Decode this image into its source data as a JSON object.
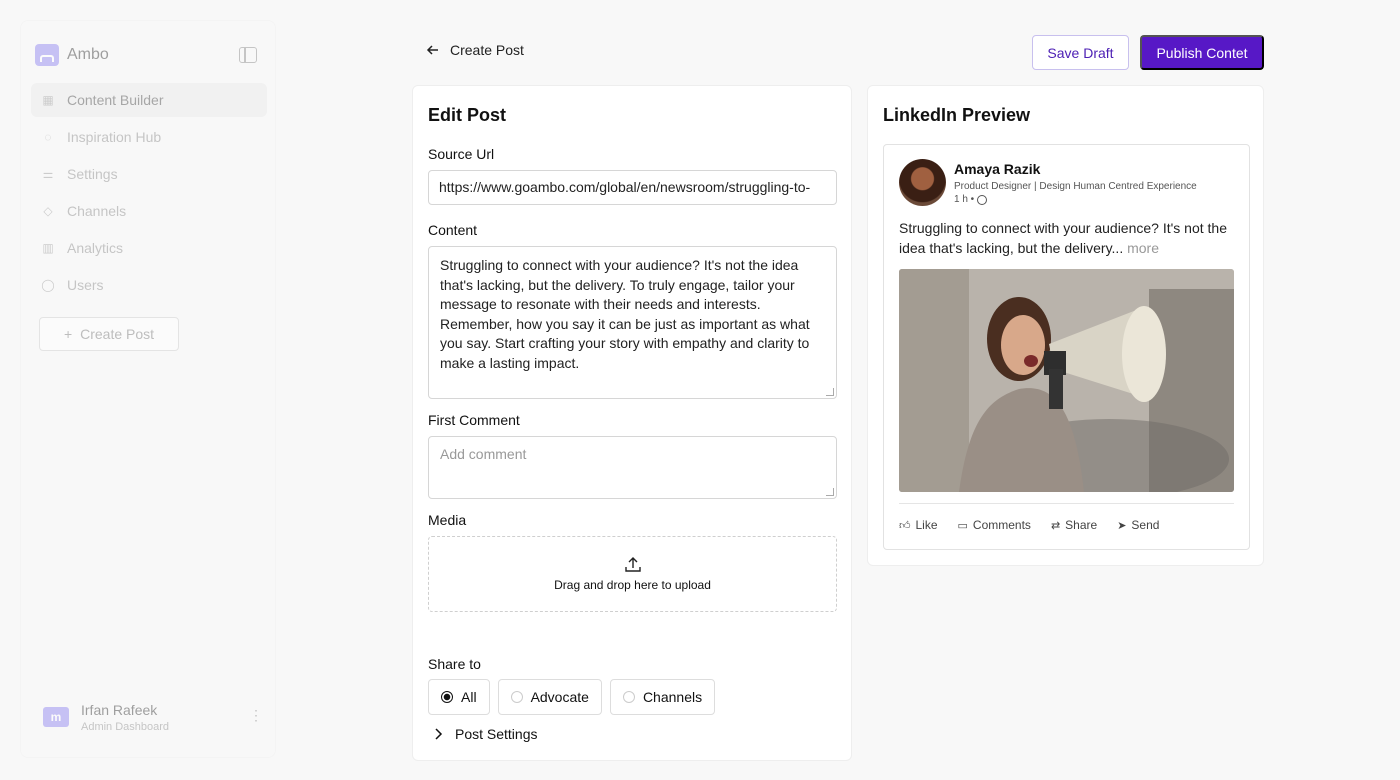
{
  "sidebar": {
    "brand": "Ambo",
    "items": [
      {
        "label": "Content Builder",
        "icon": "grid-icon",
        "active": true
      },
      {
        "label": "Inspiration Hub",
        "icon": "lightbulb-icon",
        "active": false
      },
      {
        "label": "Settings",
        "icon": "sliders-icon",
        "active": false
      },
      {
        "label": "Channels",
        "icon": "tags-icon",
        "active": false
      },
      {
        "label": "Analytics",
        "icon": "bar-chart-icon",
        "active": false
      },
      {
        "label": "Users",
        "icon": "user-icon",
        "active": false
      }
    ],
    "create_post_label": "Create Post",
    "user": {
      "name": "Irfan Rafeek",
      "role": "Admin Dashboard",
      "avatar_letter": "m"
    }
  },
  "header": {
    "back_label": "Create Post",
    "save_draft_label": "Save Draft",
    "publish_label": "Publish Contet"
  },
  "edit": {
    "title": "Edit Post",
    "source_url_label": "Source Url",
    "source_url_value": "https://www.goambo.com/global/en/newsroom/struggling-to-",
    "content_label": "Content",
    "content_value": "Struggling to connect with your audience? It's not the idea that's lacking, but the delivery. To truly engage, tailor your message to resonate with their needs and interests. Remember, how you say it can be just as important as what you say. Start crafting your story with empathy and clarity to make a lasting impact.",
    "first_comment_label": "First Comment",
    "first_comment_placeholder": "Add comment",
    "media_label": "Media",
    "upload_text": "Drag and drop here to upload",
    "share_to_label": "Share to",
    "share_options": [
      {
        "label": "All",
        "selected": true
      },
      {
        "label": "Advocate",
        "selected": false
      },
      {
        "label": "Channels",
        "selected": false
      }
    ],
    "post_settings_label": "Post Settings"
  },
  "preview": {
    "title": "LinkedIn Preview",
    "author_name": "Amaya Razik",
    "author_title": "Product Designer | Design Human Centred Experience",
    "time": "1 h •",
    "text": "Struggling to connect with your audience? It's not the idea that's lacking, but the delivery...",
    "more_label": "more",
    "actions": [
      "Like",
      "Comments",
      "Share",
      "Send"
    ]
  },
  "colors": {
    "accent": "#5718c6",
    "brand": "#8b7ff0"
  }
}
